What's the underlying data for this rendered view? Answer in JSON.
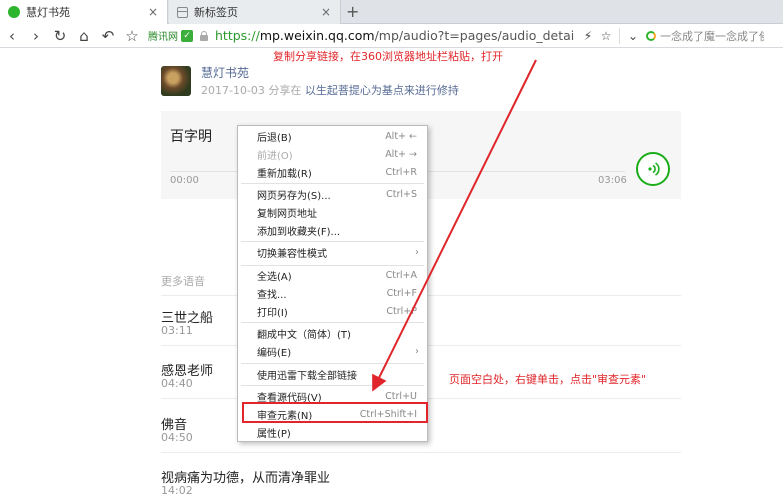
{
  "tabs": [
    {
      "title": "慧灯书苑",
      "close": "×"
    },
    {
      "title": "新标签页",
      "close": "×"
    }
  ],
  "new_tab": "+",
  "navbar": {
    "back": "‹",
    "forward": "›",
    "refresh": "↻",
    "home": "⌂",
    "undo": "↶",
    "star": "☆",
    "security_label": "腾讯网",
    "security_shield": "✓",
    "url_proto": "https://",
    "url_host": "mp.weixin.qq.com",
    "url_path": "/mp/audio?t=pages/audio_detail&scen",
    "bolt": "⚡",
    "star2": "☆",
    "dropdown": "⌄",
    "search_text": "一念成了魔一念成了佛"
  },
  "article": {
    "author": "慧灯书苑",
    "date": "2017-10-03",
    "shared_prefix": "分享在",
    "shared_title": "以生起菩提心为基点来进行修持"
  },
  "audio": {
    "title": "百字明",
    "start": "00:00",
    "end": "03:06"
  },
  "more": {
    "title": "更多语音",
    "tracks": [
      {
        "name": "三世之船",
        "duration": "03:11"
      },
      {
        "name": "感恩老师",
        "duration": "04:40"
      },
      {
        "name": "佛音",
        "duration": "04:50"
      },
      {
        "name": "视病痛为功德，从而清净罪业",
        "duration": "14:02"
      }
    ]
  },
  "context_menu": {
    "items": [
      {
        "label": "后退(B)",
        "key": "Alt+ ←"
      },
      {
        "label": "前进(O)",
        "key": "Alt+ →"
      },
      {
        "label": "重新加载(R)",
        "key": "Ctrl+R"
      },
      {
        "label": "网页另存为(S)...",
        "key": "Ctrl+S"
      },
      {
        "label": "复制网页地址",
        "key": ""
      },
      {
        "label": "添加到收藏夹(F)...",
        "key": ""
      },
      {
        "label": "切换兼容性模式",
        "key": ""
      },
      {
        "label": "全选(A)",
        "key": "Ctrl+A"
      },
      {
        "label": "查找...",
        "key": "Ctrl+F"
      },
      {
        "label": "打印(I)",
        "key": "Ctrl+P"
      },
      {
        "label": "翻成中文（简体）(T)",
        "key": ""
      },
      {
        "label": "编码(E)",
        "key": ""
      },
      {
        "label": "使用迅雷下载全部链接",
        "key": ""
      },
      {
        "label": "查看源代码(V)",
        "key": "Ctrl+U"
      },
      {
        "label": "审查元素(N)",
        "key": "Ctrl+Shift+I"
      },
      {
        "label": "属性(P)",
        "key": ""
      }
    ],
    "submenu_arrow": "›"
  },
  "annotations": {
    "top": "复制分享链接，在360浏览器地址栏粘贴，打开",
    "right": "页面空白处，右键单击，点击\"审查元素\""
  },
  "colors": {
    "annotation_red": "#e0262a",
    "wechat_green": "#1aad19",
    "link_blue": "#576b95"
  }
}
